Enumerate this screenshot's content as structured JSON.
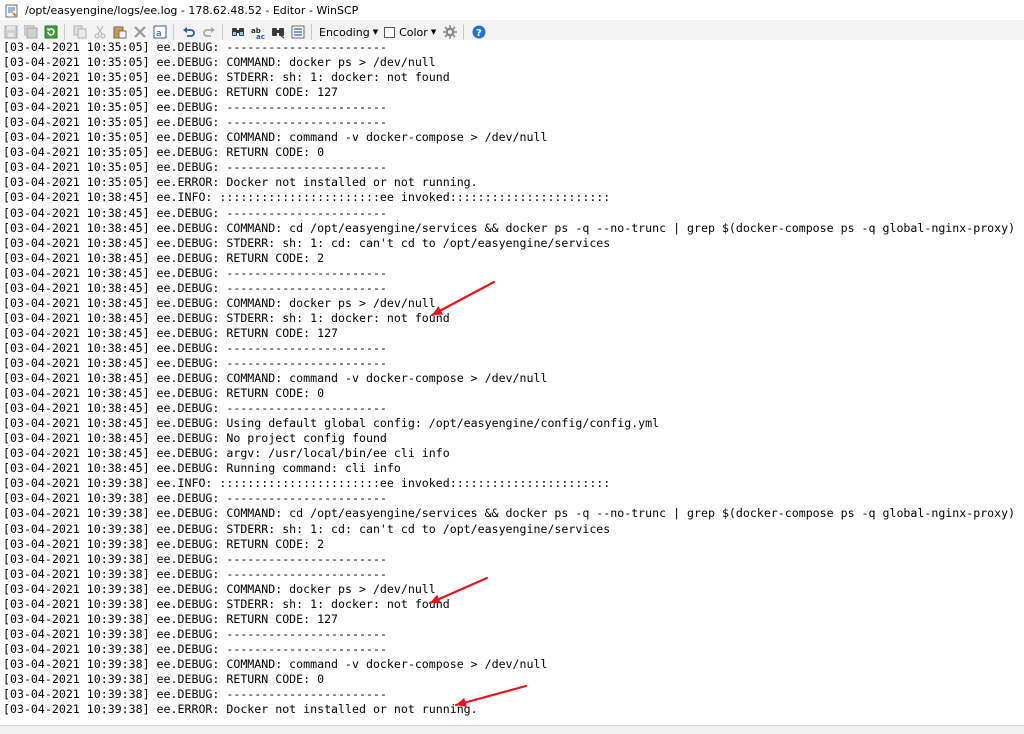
{
  "window": {
    "title": "/opt/easyengine/logs/ee.log - 178.62.48.52 - Editor - WinSCP"
  },
  "toolbar": {
    "buttons": [
      {
        "icon": "save-icon",
        "enabled": false
      },
      {
        "icon": "save-all-icon",
        "enabled": false
      },
      {
        "icon": "reload-icon",
        "enabled": true
      },
      {
        "icon": "copy-icon",
        "enabled": false
      },
      {
        "icon": "cut-icon",
        "enabled": false
      },
      {
        "icon": "paste-icon",
        "enabled": true
      },
      {
        "icon": "delete-icon",
        "enabled": false
      },
      {
        "icon": "select-all-icon",
        "enabled": true
      },
      {
        "icon": "undo-icon",
        "enabled": true
      },
      {
        "icon": "redo-icon",
        "enabled": false
      },
      {
        "icon": "find-icon",
        "enabled": true
      },
      {
        "icon": "replace-icon",
        "enabled": true
      },
      {
        "icon": "find-next-icon",
        "enabled": true
      },
      {
        "icon": "goto-line-icon",
        "enabled": true
      }
    ],
    "encoding_label": "Encoding",
    "color_label": "Color",
    "settings_icon": "gear-icon",
    "help_icon": "help-icon"
  },
  "editor": {
    "lines": [
      "[03-04-2021 10:35:05] ee.DEBUG: -----------------------",
      "[03-04-2021 10:35:05] ee.DEBUG: COMMAND: docker ps > /dev/null",
      "[03-04-2021 10:35:05] ee.DEBUG: STDERR: sh: 1: docker: not found",
      "[03-04-2021 10:35:05] ee.DEBUG: RETURN CODE: 127",
      "[03-04-2021 10:35:05] ee.DEBUG: -----------------------",
      "[03-04-2021 10:35:05] ee.DEBUG: -----------------------",
      "[03-04-2021 10:35:05] ee.DEBUG: COMMAND: command -v docker-compose > /dev/null",
      "[03-04-2021 10:35:05] ee.DEBUG: RETURN CODE: 0",
      "[03-04-2021 10:35:05] ee.DEBUG: -----------------------",
      "[03-04-2021 10:35:05] ee.ERROR: Docker not installed or not running.",
      "[03-04-2021 10:38:45] ee.INFO: :::::::::::::::::::::::ee invoked:::::::::::::::::::::::",
      "[03-04-2021 10:38:45] ee.DEBUG: -----------------------",
      "[03-04-2021 10:38:45] ee.DEBUG: COMMAND: cd /opt/easyengine/services && docker ps -q --no-trunc | grep $(docker-compose ps -q global-nginx-proxy)",
      "[03-04-2021 10:38:45] ee.DEBUG: STDERR: sh: 1: cd: can't cd to /opt/easyengine/services",
      "[03-04-2021 10:38:45] ee.DEBUG: RETURN CODE: 2",
      "[03-04-2021 10:38:45] ee.DEBUG: -----------------------",
      "[03-04-2021 10:38:45] ee.DEBUG: -----------------------",
      "[03-04-2021 10:38:45] ee.DEBUG: COMMAND: docker ps > /dev/null",
      "[03-04-2021 10:38:45] ee.DEBUG: STDERR: sh: 1: docker: not found",
      "[03-04-2021 10:38:45] ee.DEBUG: RETURN CODE: 127",
      "[03-04-2021 10:38:45] ee.DEBUG: -----------------------",
      "[03-04-2021 10:38:45] ee.DEBUG: -----------------------",
      "[03-04-2021 10:38:45] ee.DEBUG: COMMAND: command -v docker-compose > /dev/null",
      "[03-04-2021 10:38:45] ee.DEBUG: RETURN CODE: 0",
      "[03-04-2021 10:38:45] ee.DEBUG: -----------------------",
      "[03-04-2021 10:38:45] ee.DEBUG: Using default global config: /opt/easyengine/config/config.yml",
      "[03-04-2021 10:38:45] ee.DEBUG: No project config found",
      "[03-04-2021 10:38:45] ee.DEBUG: argv: /usr/local/bin/ee cli info",
      "[03-04-2021 10:38:45] ee.DEBUG: Running command: cli info",
      "[03-04-2021 10:39:38] ee.INFO: :::::::::::::::::::::::ee invoked:::::::::::::::::::::::",
      "[03-04-2021 10:39:38] ee.DEBUG: -----------------------",
      "[03-04-2021 10:39:38] ee.DEBUG: COMMAND: cd /opt/easyengine/services && docker ps -q --no-trunc | grep $(docker-compose ps -q global-nginx-proxy)",
      "[03-04-2021 10:39:38] ee.DEBUG: STDERR: sh: 1: cd: can't cd to /opt/easyengine/services",
      "[03-04-2021 10:39:38] ee.DEBUG: RETURN CODE: 2",
      "[03-04-2021 10:39:38] ee.DEBUG: -----------------------",
      "[03-04-2021 10:39:38] ee.DEBUG: -----------------------",
      "[03-04-2021 10:39:38] ee.DEBUG: COMMAND: docker ps > /dev/null",
      "[03-04-2021 10:39:38] ee.DEBUG: STDERR: sh: 1: docker: not found",
      "[03-04-2021 10:39:38] ee.DEBUG: RETURN CODE: 127",
      "[03-04-2021 10:39:38] ee.DEBUG: -----------------------",
      "[03-04-2021 10:39:38] ee.DEBUG: -----------------------",
      "[03-04-2021 10:39:38] ee.DEBUG: COMMAND: command -v docker-compose > /dev/null",
      "[03-04-2021 10:39:38] ee.DEBUG: RETURN CODE: 0",
      "[03-04-2021 10:39:38] ee.DEBUG: -----------------------",
      "[03-04-2021 10:39:38] ee.ERROR: Docker not installed or not running."
    ]
  },
  "annotations": {
    "arrow_color": "#e8141c"
  }
}
